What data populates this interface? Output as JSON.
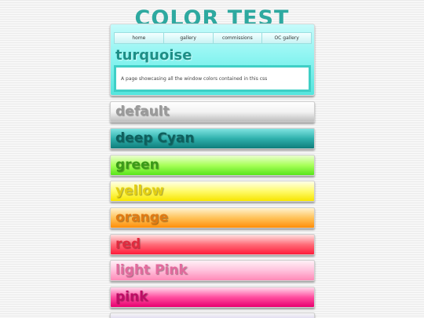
{
  "site": {
    "title": "COLOR TEST"
  },
  "nav": {
    "items": [
      "home",
      "gallery",
      "commissions",
      "OC gallery"
    ]
  },
  "header": {
    "heading": "turquoise",
    "description": "A page showcasing all the window colors contained in this css"
  },
  "swatches": [
    {
      "label": "default",
      "color": "#e6e6e6"
    },
    {
      "label": "deep Cyan",
      "color": "#2fb1ad"
    },
    {
      "label": "green",
      "color": "#a8ff59"
    },
    {
      "label": "yellow",
      "color": "#fffb6b"
    },
    {
      "label": "orange",
      "color": "#ffc35a"
    },
    {
      "label": "red",
      "color": "#ff6b78"
    },
    {
      "label": "light Pink",
      "color": "#ffc1dc"
    },
    {
      "label": "pink",
      "color": "#ff4fa0"
    }
  ],
  "colors": {
    "title": "#2ea9a0",
    "header_bg": "#8ff5f2",
    "header_border": "#3fcfc6"
  }
}
